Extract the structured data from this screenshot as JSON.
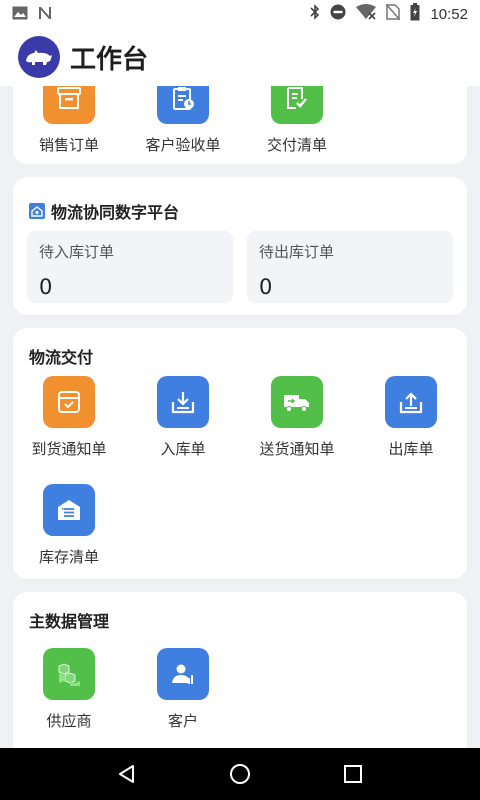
{
  "status_bar": {
    "time": "10:52",
    "left_icons": [
      "image-icon",
      "n-icon"
    ],
    "right_icons": [
      "bluetooth-icon",
      "do-not-disturb-icon",
      "wifi-icon",
      "no-sim-icon",
      "battery-icon"
    ]
  },
  "header": {
    "title": "工作台"
  },
  "sales_card": {
    "items": [
      {
        "label": "销售订单",
        "icon": "archive-box-icon",
        "color": "#f0902e"
      },
      {
        "label": "客户验收单",
        "icon": "clipboard-icon",
        "color": "#3f7fe0"
      },
      {
        "label": "交付清单",
        "icon": "checklist-icon",
        "color": "#52c048"
      }
    ]
  },
  "logistics_platform": {
    "title": "物流协同数字平台",
    "stats": [
      {
        "label": "待入库订单",
        "value": "0"
      },
      {
        "label": "待出库订单",
        "value": "0"
      }
    ]
  },
  "logistics_delivery": {
    "title": "物流交付",
    "items": [
      {
        "label": "到货通知单",
        "icon": "inbox-check-icon",
        "color": "#f0902e"
      },
      {
        "label": "入库单",
        "icon": "inbound-icon",
        "color": "#3f7fe0"
      },
      {
        "label": "送货通知单",
        "icon": "truck-icon",
        "color": "#52c048"
      },
      {
        "label": "出库单",
        "icon": "outbound-icon",
        "color": "#3f7fe0"
      },
      {
        "label": "库存清单",
        "icon": "warehouse-icon",
        "color": "#3f7fe0"
      }
    ]
  },
  "master_data": {
    "title": "主数据管理",
    "items": [
      {
        "label": "供应商",
        "icon": "boxes-icon",
        "color": "#52c048"
      },
      {
        "label": "客户",
        "icon": "customer-icon",
        "color": "#3f7fe0"
      }
    ]
  },
  "nav_bar": {
    "buttons": [
      "back-icon",
      "home-icon",
      "recents-icon"
    ]
  }
}
